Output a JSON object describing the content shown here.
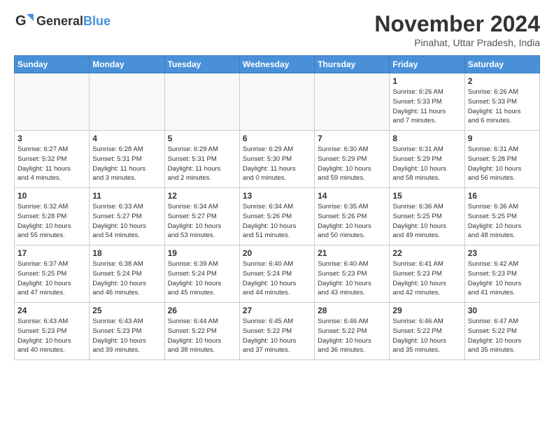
{
  "header": {
    "logo_general": "General",
    "logo_blue": "Blue",
    "title": "November 2024",
    "location": "Pinahat, Uttar Pradesh, India"
  },
  "weekdays": [
    "Sunday",
    "Monday",
    "Tuesday",
    "Wednesday",
    "Thursday",
    "Friday",
    "Saturday"
  ],
  "weeks": [
    [
      {
        "day": "",
        "info": "",
        "empty": true
      },
      {
        "day": "",
        "info": "",
        "empty": true
      },
      {
        "day": "",
        "info": "",
        "empty": true
      },
      {
        "day": "",
        "info": "",
        "empty": true
      },
      {
        "day": "",
        "info": "",
        "empty": true
      },
      {
        "day": "1",
        "info": "Sunrise: 6:26 AM\nSunset: 5:33 PM\nDaylight: 11 hours\nand 7 minutes."
      },
      {
        "day": "2",
        "info": "Sunrise: 6:26 AM\nSunset: 5:33 PM\nDaylight: 11 hours\nand 6 minutes."
      }
    ],
    [
      {
        "day": "3",
        "info": "Sunrise: 6:27 AM\nSunset: 5:32 PM\nDaylight: 11 hours\nand 4 minutes."
      },
      {
        "day": "4",
        "info": "Sunrise: 6:28 AM\nSunset: 5:31 PM\nDaylight: 11 hours\nand 3 minutes."
      },
      {
        "day": "5",
        "info": "Sunrise: 6:29 AM\nSunset: 5:31 PM\nDaylight: 11 hours\nand 2 minutes."
      },
      {
        "day": "6",
        "info": "Sunrise: 6:29 AM\nSunset: 5:30 PM\nDaylight: 11 hours\nand 0 minutes."
      },
      {
        "day": "7",
        "info": "Sunrise: 6:30 AM\nSunset: 5:29 PM\nDaylight: 10 hours\nand 59 minutes."
      },
      {
        "day": "8",
        "info": "Sunrise: 6:31 AM\nSunset: 5:29 PM\nDaylight: 10 hours\nand 58 minutes."
      },
      {
        "day": "9",
        "info": "Sunrise: 6:31 AM\nSunset: 5:28 PM\nDaylight: 10 hours\nand 56 minutes."
      }
    ],
    [
      {
        "day": "10",
        "info": "Sunrise: 6:32 AM\nSunset: 5:28 PM\nDaylight: 10 hours\nand 55 minutes."
      },
      {
        "day": "11",
        "info": "Sunrise: 6:33 AM\nSunset: 5:27 PM\nDaylight: 10 hours\nand 54 minutes."
      },
      {
        "day": "12",
        "info": "Sunrise: 6:34 AM\nSunset: 5:27 PM\nDaylight: 10 hours\nand 53 minutes."
      },
      {
        "day": "13",
        "info": "Sunrise: 6:34 AM\nSunset: 5:26 PM\nDaylight: 10 hours\nand 51 minutes."
      },
      {
        "day": "14",
        "info": "Sunrise: 6:35 AM\nSunset: 5:26 PM\nDaylight: 10 hours\nand 50 minutes."
      },
      {
        "day": "15",
        "info": "Sunrise: 6:36 AM\nSunset: 5:25 PM\nDaylight: 10 hours\nand 49 minutes."
      },
      {
        "day": "16",
        "info": "Sunrise: 6:36 AM\nSunset: 5:25 PM\nDaylight: 10 hours\nand 48 minutes."
      }
    ],
    [
      {
        "day": "17",
        "info": "Sunrise: 6:37 AM\nSunset: 5:25 PM\nDaylight: 10 hours\nand 47 minutes."
      },
      {
        "day": "18",
        "info": "Sunrise: 6:38 AM\nSunset: 5:24 PM\nDaylight: 10 hours\nand 46 minutes."
      },
      {
        "day": "19",
        "info": "Sunrise: 6:39 AM\nSunset: 5:24 PM\nDaylight: 10 hours\nand 45 minutes."
      },
      {
        "day": "20",
        "info": "Sunrise: 6:40 AM\nSunset: 5:24 PM\nDaylight: 10 hours\nand 44 minutes."
      },
      {
        "day": "21",
        "info": "Sunrise: 6:40 AM\nSunset: 5:23 PM\nDaylight: 10 hours\nand 43 minutes."
      },
      {
        "day": "22",
        "info": "Sunrise: 6:41 AM\nSunset: 5:23 PM\nDaylight: 10 hours\nand 42 minutes."
      },
      {
        "day": "23",
        "info": "Sunrise: 6:42 AM\nSunset: 5:23 PM\nDaylight: 10 hours\nand 41 minutes."
      }
    ],
    [
      {
        "day": "24",
        "info": "Sunrise: 6:43 AM\nSunset: 5:23 PM\nDaylight: 10 hours\nand 40 minutes."
      },
      {
        "day": "25",
        "info": "Sunrise: 6:43 AM\nSunset: 5:23 PM\nDaylight: 10 hours\nand 39 minutes."
      },
      {
        "day": "26",
        "info": "Sunrise: 6:44 AM\nSunset: 5:22 PM\nDaylight: 10 hours\nand 38 minutes."
      },
      {
        "day": "27",
        "info": "Sunrise: 6:45 AM\nSunset: 5:22 PM\nDaylight: 10 hours\nand 37 minutes."
      },
      {
        "day": "28",
        "info": "Sunrise: 6:46 AM\nSunset: 5:22 PM\nDaylight: 10 hours\nand 36 minutes."
      },
      {
        "day": "29",
        "info": "Sunrise: 6:46 AM\nSunset: 5:22 PM\nDaylight: 10 hours\nand 35 minutes."
      },
      {
        "day": "30",
        "info": "Sunrise: 6:47 AM\nSunset: 5:22 PM\nDaylight: 10 hours\nand 35 minutes."
      }
    ]
  ]
}
